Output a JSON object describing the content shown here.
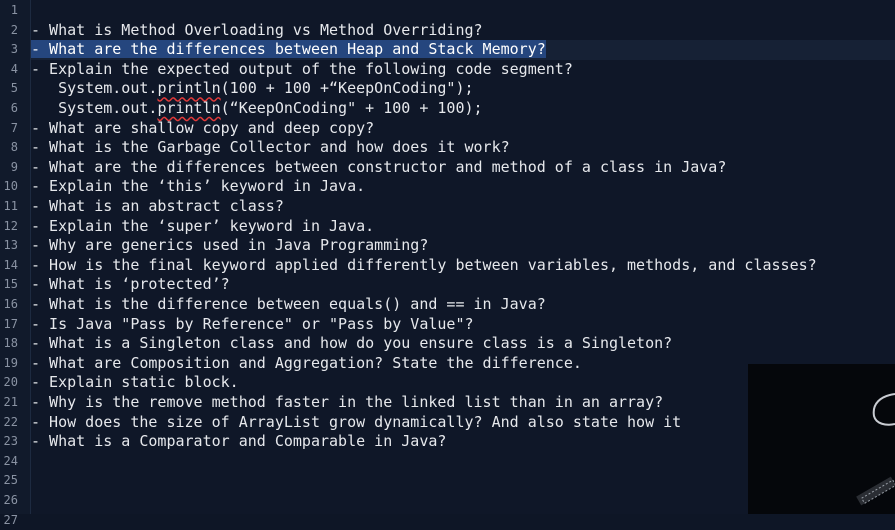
{
  "editor": {
    "gutter_numbers": [
      "1",
      "2",
      "3",
      "4",
      "5",
      "6",
      "7",
      "8",
      "9",
      "10",
      "11",
      "12",
      "13",
      "14",
      "15",
      "16",
      "17",
      "18",
      "19",
      "20",
      "21",
      "22",
      "23",
      "24",
      "25",
      "26",
      "27"
    ],
    "lines": [
      "",
      "- What is Method Overloading vs Method Overriding?",
      "- What are the differences between Heap and Stack Memory?",
      "- Explain the expected output of the following code segment?",
      "   System.out.println(100 + 100 +“KeepOnCoding\");",
      "   System.out.println(“KeepOnCoding\" + 100 + 100);",
      "- What are shallow copy and deep copy?",
      "- What is the Garbage Collector and how does it work?",
      "- What are the differences between constructor and method of a class in Java?",
      "- Explain the ‘this’ keyword in Java.",
      "- What is an abstract class?",
      "- Explain the ‘super’ keyword in Java.",
      "- Why are generics used in Java Programming?",
      "- How is the final keyword applied differently between variables, methods, and classes?",
      "- What is ‘protected’?",
      "- What is the difference between equals() and == in Java?",
      "- Is Java \"Pass by Reference\" or \"Pass by Value\"?",
      "- What is a Singleton class and how do you ensure class is a Singleton?",
      "- What are Composition and Aggregation? State the difference.",
      "- Explain static block.",
      "- Why is the remove method faster in the linked list than in an array?",
      "- How does the size of ArrayList grow dynamically? And also state how it",
      "- What is a Comparator and Comparable in Java?",
      "",
      "",
      "",
      ""
    ],
    "current_line_index": 2,
    "selection_line_index": 2,
    "squiggle_word": "println"
  },
  "colors": {
    "background": "#0f1728",
    "selection": "#25467e",
    "text": "#e6e8ec",
    "line_numbers": "#8a93a3",
    "error_underline": "#e23a3a"
  }
}
